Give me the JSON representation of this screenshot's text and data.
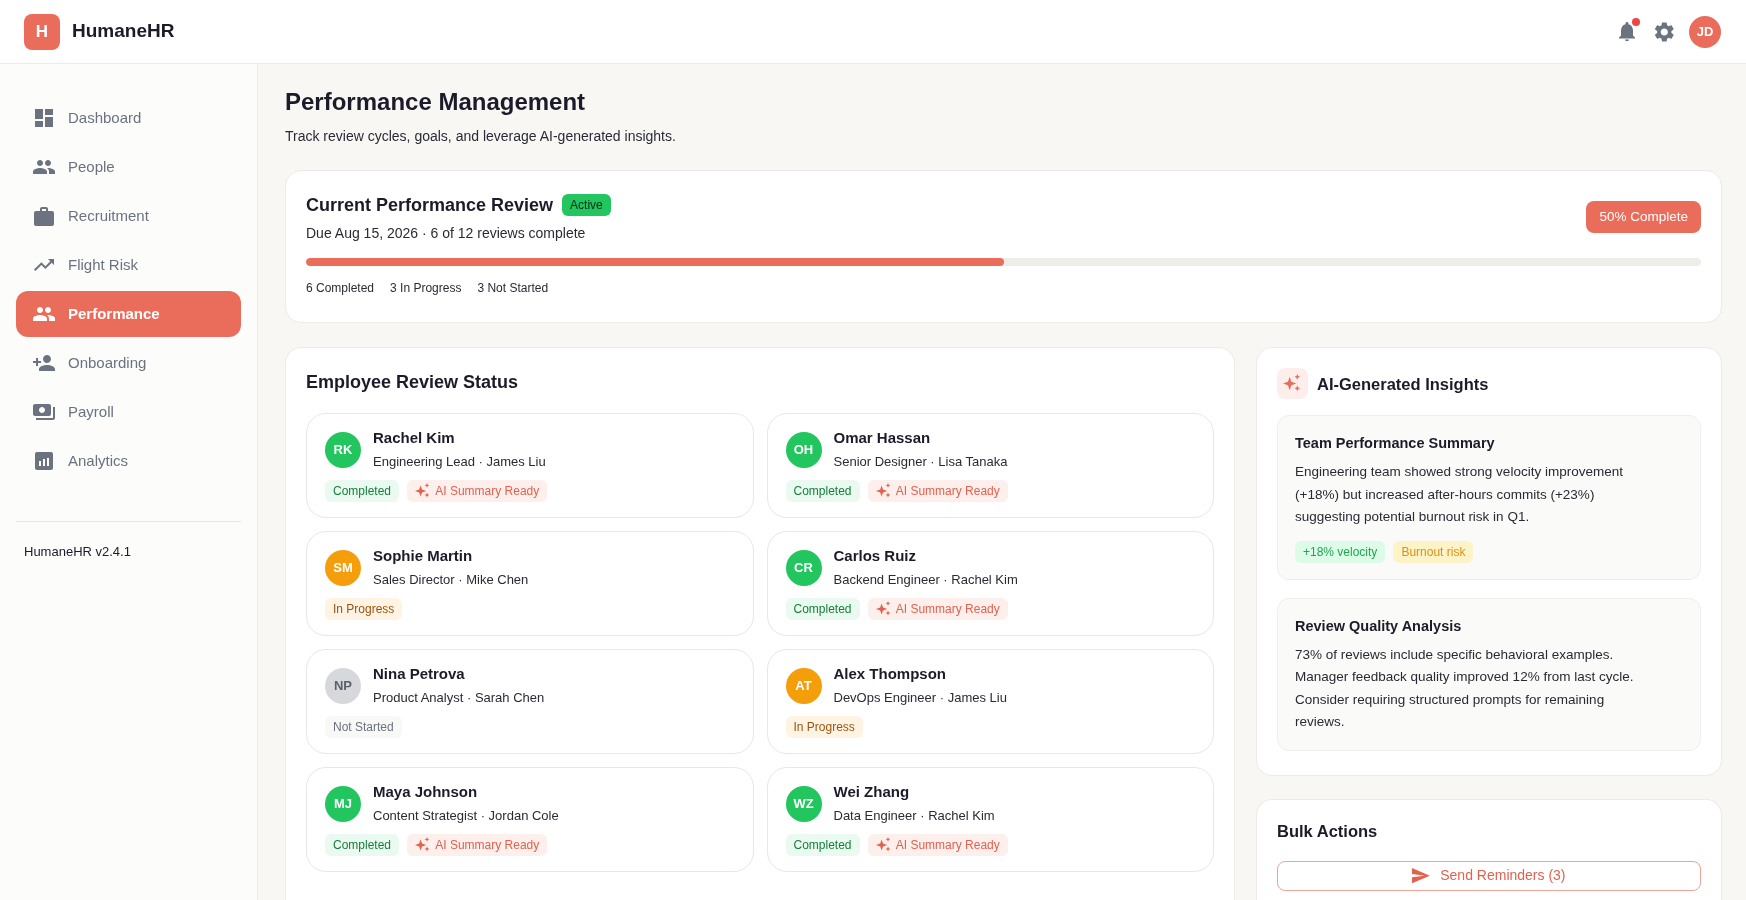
{
  "app": {
    "logo_letter": "H",
    "name": "HumaneHR"
  },
  "header": {
    "unread_notifications": true,
    "user_initials": "JD"
  },
  "sidebar": {
    "items": [
      {
        "label": "Dashboard",
        "selected": false
      },
      {
        "label": "People",
        "selected": false
      },
      {
        "label": "Recruitment",
        "selected": false
      },
      {
        "label": "Flight Risk",
        "selected": false
      },
      {
        "label": "Performance",
        "selected": true
      },
      {
        "label": "Onboarding",
        "selected": false
      },
      {
        "label": "Payroll",
        "selected": false
      },
      {
        "label": "Analytics",
        "selected": false
      }
    ],
    "version": "HumaneHR v2.4.1"
  },
  "page": {
    "title": "Performance Management",
    "subtitle": "Track review cycles, goals, and leverage AI-generated insights."
  },
  "review": {
    "title": "Current Performance Review",
    "status": "Active",
    "subtitle": "Due Aug 15, 2026 · 6 of 12 reviews complete",
    "completion": "50% Complete",
    "progress": {
      "level": 0.5
    },
    "counts": [
      "6 Completed",
      "3 In Progress",
      "3 Not Started"
    ]
  },
  "employee_review_status": {
    "title": "Employee Review Status",
    "employees": [
      {
        "initials": "RK",
        "name": "Rachel Kim",
        "detail": "Engineering Lead · James Liu",
        "status": {
          "label": "Completed",
          "kind": "completed"
        },
        "ai_summary": "AI Summary Ready"
      },
      {
        "initials": "OH",
        "name": "Omar Hassan",
        "detail": "Senior Designer · Lisa Tanaka",
        "status": {
          "label": "Completed",
          "kind": "completed"
        },
        "ai_summary": "AI Summary Ready"
      },
      {
        "initials": "SM",
        "name": "Sophie Martin",
        "detail": "Sales Director · Mike Chen",
        "status": {
          "label": "In Progress",
          "kind": "in_progress"
        }
      },
      {
        "initials": "CR",
        "name": "Carlos Ruiz",
        "detail": "Backend Engineer · Rachel Kim",
        "status": {
          "label": "Completed",
          "kind": "completed"
        },
        "ai_summary": "AI Summary Ready"
      },
      {
        "initials": "NP",
        "name": "Nina Petrova",
        "detail": "Product Analyst · Sarah Chen",
        "status": {
          "label": "Not Started",
          "kind": "not_started"
        }
      },
      {
        "initials": "AT",
        "name": "Alex Thompson",
        "detail": "DevOps Engineer · James Liu",
        "status": {
          "label": "In Progress",
          "kind": "in_progress"
        }
      },
      {
        "initials": "MJ",
        "name": "Maya Johnson",
        "detail": "Content Strategist · Jordan Cole",
        "status": {
          "label": "Completed",
          "kind": "completed"
        },
        "ai_summary": "AI Summary Ready"
      },
      {
        "initials": "WZ",
        "name": "Wei Zhang",
        "detail": "Data Engineer · Rachel Kim",
        "status": {
          "label": "Completed",
          "kind": "completed"
        },
        "ai_summary": "AI Summary Ready"
      }
    ]
  },
  "ai_insights": {
    "title": "AI-Generated Insights",
    "cards": [
      {
        "title": "Team Performance Summary",
        "body": "Engineering team showed strong velocity improvement (+18%) but increased after-hours commits (+23%) suggesting potential burnout risk in Q1.",
        "tags": [
          {
            "label": "+18% velocity",
            "kind": "positive"
          },
          {
            "label": "Burnout risk",
            "kind": "warning"
          }
        ]
      },
      {
        "title": "Review Quality Analysis",
        "body": "73% of reviews include specific behavioral examples. Manager feedback quality improved 12% from last cycle. Consider requiring structured prompts for remaining reviews."
      }
    ]
  },
  "bulk_actions": {
    "title": "Bulk Actions",
    "buttons": [
      {
        "label": "Send Reminders (3)"
      }
    ]
  }
}
